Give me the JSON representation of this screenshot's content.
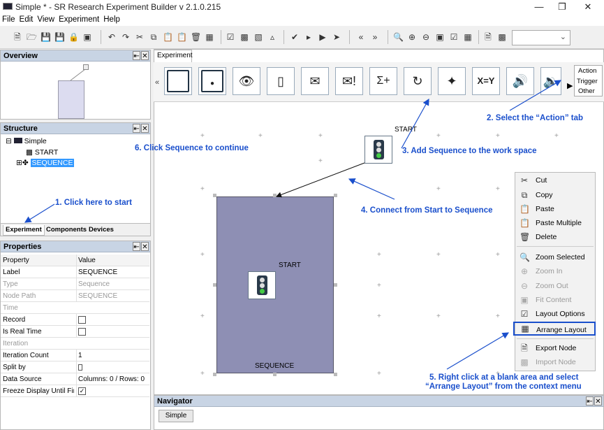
{
  "window": {
    "title": "Simple * - SR Research Experiment Builder v 2.1.0.215"
  },
  "menu": [
    "File",
    "Edit",
    "View",
    "Experiment",
    "Help"
  ],
  "overview": {
    "title": "Overview"
  },
  "structure": {
    "title": "Structure",
    "root": "Simple",
    "children": [
      "START",
      "SEQUENCE"
    ],
    "tabs": [
      "Experiment",
      "Components",
      "Devices"
    ]
  },
  "properties": {
    "title": "Properties",
    "headers": [
      "Property",
      "Value"
    ],
    "rows": [
      {
        "k": "Label",
        "v": "SEQUENCE"
      },
      {
        "k": "Type",
        "v": "Sequence"
      },
      {
        "k": "Node Path",
        "v": "SEQUENCE"
      },
      {
        "k": "Time",
        "v": ""
      },
      {
        "k": "Record",
        "v": ""
      },
      {
        "k": "Is Real Time",
        "v": ""
      },
      {
        "k": "Iteration",
        "v": ""
      },
      {
        "k": "Iteration Count",
        "v": "1"
      },
      {
        "k": "Split by",
        "v": ""
      },
      {
        "k": "Data Source",
        "v": "Columns: 0 / Rows: 0"
      },
      {
        "k": "Freeze Display Until Fir...",
        "v": ""
      }
    ]
  },
  "workspace": {
    "tab": "Experiment",
    "palette_tabs": [
      "Action",
      "Trigger",
      "Other"
    ],
    "palette_icons": [
      "display-screen-icon",
      "drift-correct-icon",
      "camera-setup-icon",
      "mouse-icon",
      "send-email-icon",
      "error-message-icon",
      "add-to-accumulator-icon",
      "cycle-icon",
      "navigation-icon",
      "update-attribute-icon",
      "play-sound-icon",
      "play-sound-control-icon"
    ],
    "palette_glyphs": {
      "accum": "Σ+",
      "assign": "X=Y"
    },
    "start_label": "START",
    "sequence_label": "SEQUENCE",
    "seq_start_label": "START"
  },
  "annotations": {
    "a1": "1. Click here to start",
    "a2": "2. Select the “Action” tab",
    "a3": "3. Add Sequence to the work space",
    "a4": "4. Connect from Start to Sequence",
    "a5": "5. Right click at a blank area and select",
    "a5b": "“Arrange Layout” from the context menu",
    "a6": "6. Click Sequence to continue"
  },
  "context_menu": [
    {
      "label": "Cut",
      "enabled": true,
      "icon": "scissors-icon"
    },
    {
      "label": "Copy",
      "enabled": true,
      "icon": "copy-icon"
    },
    {
      "label": "Paste",
      "enabled": true,
      "icon": "paste-icon"
    },
    {
      "label": "Paste Multiple",
      "enabled": true,
      "icon": "paste-multiple-icon"
    },
    {
      "label": "Delete",
      "enabled": true,
      "icon": "trash-icon"
    },
    {
      "label": "Zoom Selected",
      "enabled": true,
      "icon": "zoom-selected-icon"
    },
    {
      "label": "Zoom In",
      "enabled": false,
      "icon": "zoom-in-icon"
    },
    {
      "label": "Zoom Out",
      "enabled": false,
      "icon": "zoom-out-icon"
    },
    {
      "label": "Fit Content",
      "enabled": false,
      "icon": "fit-content-icon"
    },
    {
      "label": "Layout Options",
      "enabled": true,
      "icon": "layout-options-icon"
    },
    {
      "label": "Arrange Layout",
      "enabled": true,
      "icon": "arrange-layout-icon"
    },
    {
      "label": "Export Node",
      "enabled": true,
      "icon": "export-node-icon"
    },
    {
      "label": "Import Node",
      "enabled": false,
      "icon": "import-node-icon"
    }
  ],
  "navigator": {
    "title": "Navigator",
    "tab": "Simple"
  },
  "colors": {
    "annotation": "#1a4fcc",
    "sequence_fill": "#8e8fb4",
    "selection": "#3399ff"
  }
}
